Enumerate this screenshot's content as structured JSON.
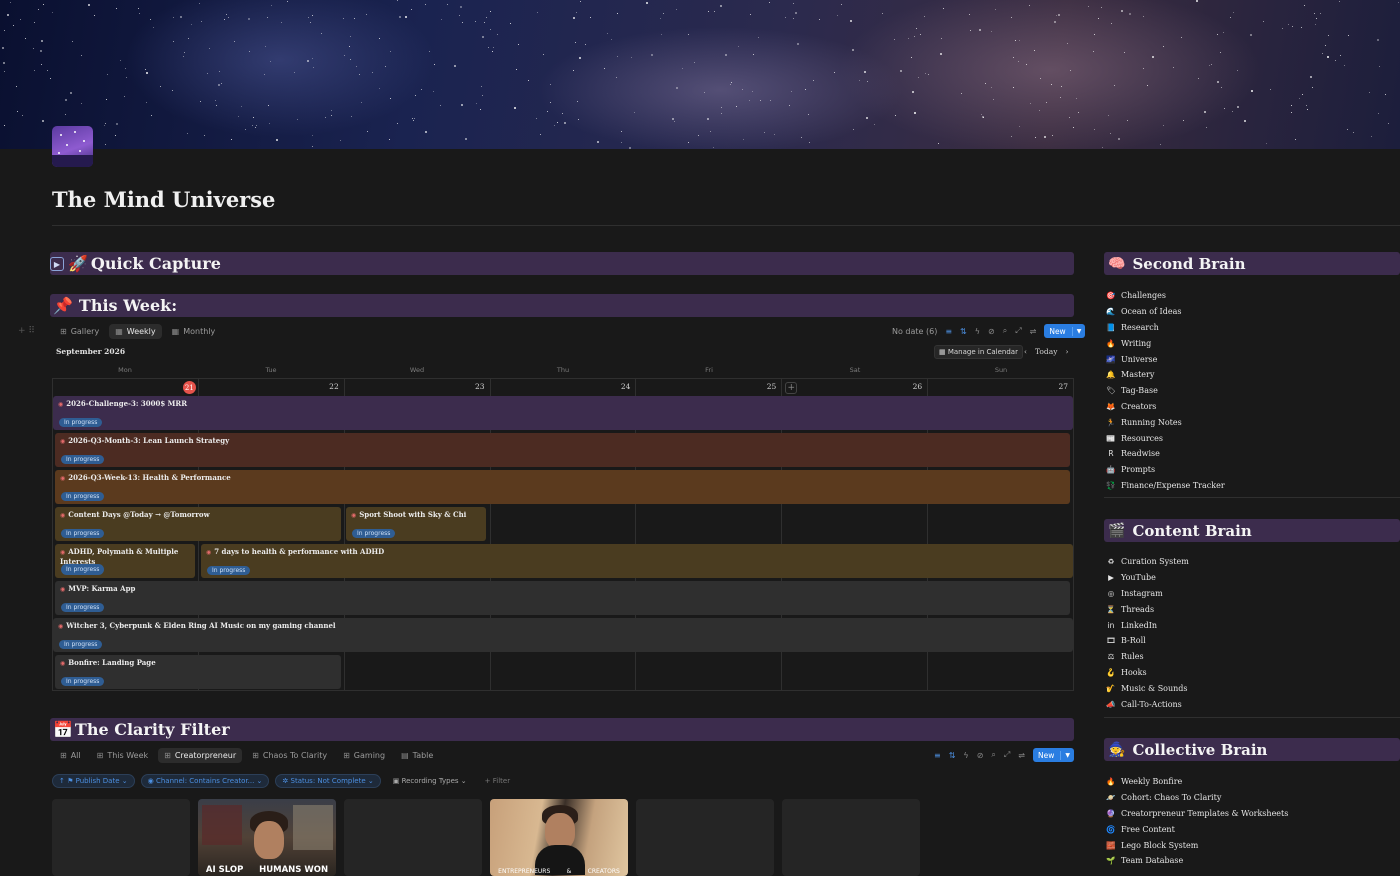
{
  "page": {
    "title": "The Mind Universe"
  },
  "quick_capture": {
    "title": "Quick Capture",
    "emoji": "🚀",
    "toggle": "▶"
  },
  "this_week": {
    "title": "This Week:",
    "emoji": "📌",
    "tabs": [
      {
        "label": "Gallery",
        "icon": "gallery-icon",
        "active": false
      },
      {
        "label": "Weekly",
        "icon": "calendar-icon",
        "active": true
      },
      {
        "label": "Monthly",
        "icon": "calendar-icon",
        "active": false
      }
    ],
    "no_date": "No date (6)",
    "new_label": "New",
    "month": "September 2026",
    "manage_label": "Manage in Calendar",
    "today_label": "Today",
    "days_of_week": [
      "Mon",
      "Tue",
      "Wed",
      "Thu",
      "Fri",
      "Sat",
      "Sun"
    ],
    "day_numbers": [
      "21",
      "22",
      "23",
      "24",
      "25",
      "26",
      "27"
    ],
    "events": [
      {
        "title": "2026-Challenge-3: 3000$ MRR",
        "status": "In progress",
        "color": "#3c2c4d"
      },
      {
        "title": "2026-Q3-Month-3: Lean Launch Strategy",
        "status": "In progress",
        "color": "#4c2b22"
      },
      {
        "title": "2026-Q3-Week-13: Health & Performance",
        "status": "In progress",
        "color": "#5b3a1e"
      },
      {
        "title": "Content Days @Today → @Tomorrow",
        "status": "In progress",
        "color": "#4a3c20"
      },
      {
        "title": "Sport Shoot with Sky & Chi",
        "status": "In progress",
        "color": "#4a3c20"
      },
      {
        "title": "ADHD, Polymath & Multiple Interests",
        "status": "In progress",
        "color": "#4a3c20"
      },
      {
        "title": "7 days to health & performance with ADHD",
        "status": "In progress",
        "color": "#4a3c20"
      },
      {
        "title": "MVP: Karma App",
        "status": "In progress",
        "color": "#2f2f2f"
      },
      {
        "title": "Witcher 3, Cyberpunk & Elden Ring AI Music on my gaming channel",
        "status": "In progress",
        "color": "#2f2f2f"
      },
      {
        "title": "Bonfire: Landing Page",
        "status": "In progress",
        "color": "#2f2f2f"
      }
    ]
  },
  "clarity_filter": {
    "title": "The Clarity Filter",
    "emoji": "📅",
    "tabs": [
      {
        "label": "All",
        "active": false
      },
      {
        "label": "This Week",
        "active": false
      },
      {
        "label": "Creatorpreneur",
        "active": true
      },
      {
        "label": "Chaos To Clarity",
        "active": false
      },
      {
        "label": "Gaming",
        "active": false
      },
      {
        "label": "Table",
        "active": false
      }
    ],
    "new_label": "New",
    "filters": [
      {
        "label": "Publish Date",
        "style": "chip"
      },
      {
        "label": "Channel: Contains Creator...",
        "style": "chip"
      },
      {
        "label": "Status: Not Complete",
        "style": "chip"
      },
      {
        "label": "Recording Types",
        "style": "plain"
      },
      {
        "label": "+ Filter",
        "style": "plain"
      }
    ],
    "card_texts": {
      "card2_left": "AI SLOP",
      "card2_right": "HUMANS WON",
      "card4_left": "ENTREPRENEURS",
      "card4_mid": "&",
      "card4_right": "CREATORS"
    }
  },
  "second_brain": {
    "title": "Second Brain",
    "emoji": "🧠",
    "items": [
      {
        "label": "Challenges",
        "icon": "🎯"
      },
      {
        "label": "Ocean of Ideas",
        "icon": "🌊"
      },
      {
        "label": "Research",
        "icon": "📘"
      },
      {
        "label": "Writing",
        "icon": "🔥"
      },
      {
        "label": "Universe",
        "icon": "🌌"
      },
      {
        "label": "Mastery",
        "icon": "🔔"
      },
      {
        "label": "Tag-Base",
        "icon": "🏷"
      },
      {
        "label": "Creators",
        "icon": "🦊"
      },
      {
        "label": "Running Notes",
        "icon": "🏃"
      },
      {
        "label": "Resources",
        "icon": "📰"
      },
      {
        "label": "Readwise",
        "icon": "R"
      },
      {
        "label": "Prompts",
        "icon": "🤖"
      },
      {
        "label": "Finance/Expense Tracker",
        "icon": "💱"
      }
    ]
  },
  "content_brain": {
    "title": "Content Brain",
    "emoji": "🎬",
    "items": [
      {
        "label": "Curation System",
        "icon": "♻"
      },
      {
        "label": "YouTube",
        "icon": "▶"
      },
      {
        "label": "Instagram",
        "icon": "◎"
      },
      {
        "label": "Threads",
        "icon": "⏳"
      },
      {
        "label": "LinkedIn",
        "icon": "in"
      },
      {
        "label": "B-Roll",
        "icon": "🎞"
      },
      {
        "label": "Rules",
        "icon": "⚖"
      },
      {
        "label": "Hooks",
        "icon": "🪝"
      },
      {
        "label": "Music & Sounds",
        "icon": "🎷"
      },
      {
        "label": "Call-To-Actions",
        "icon": "📣"
      }
    ]
  },
  "collective_brain": {
    "title": "Collective Brain",
    "emoji": "🧙",
    "items": [
      {
        "label": "Weekly Bonfire",
        "icon": "🔥"
      },
      {
        "label": "Cohort: Chaos To Clarity",
        "icon": "🪐"
      },
      {
        "label": "Creatorpreneur Templates & Worksheets",
        "icon": "🔮"
      },
      {
        "label": "Free Content",
        "icon": "🌀"
      },
      {
        "label": "Lego Block System",
        "icon": "🧱"
      },
      {
        "label": "Team Database",
        "icon": "🌱"
      }
    ]
  },
  "colors": {
    "accent": "#2a7de1",
    "heading_bar": "#3c2c4d",
    "today": "#e5534b",
    "background": "#191919"
  }
}
